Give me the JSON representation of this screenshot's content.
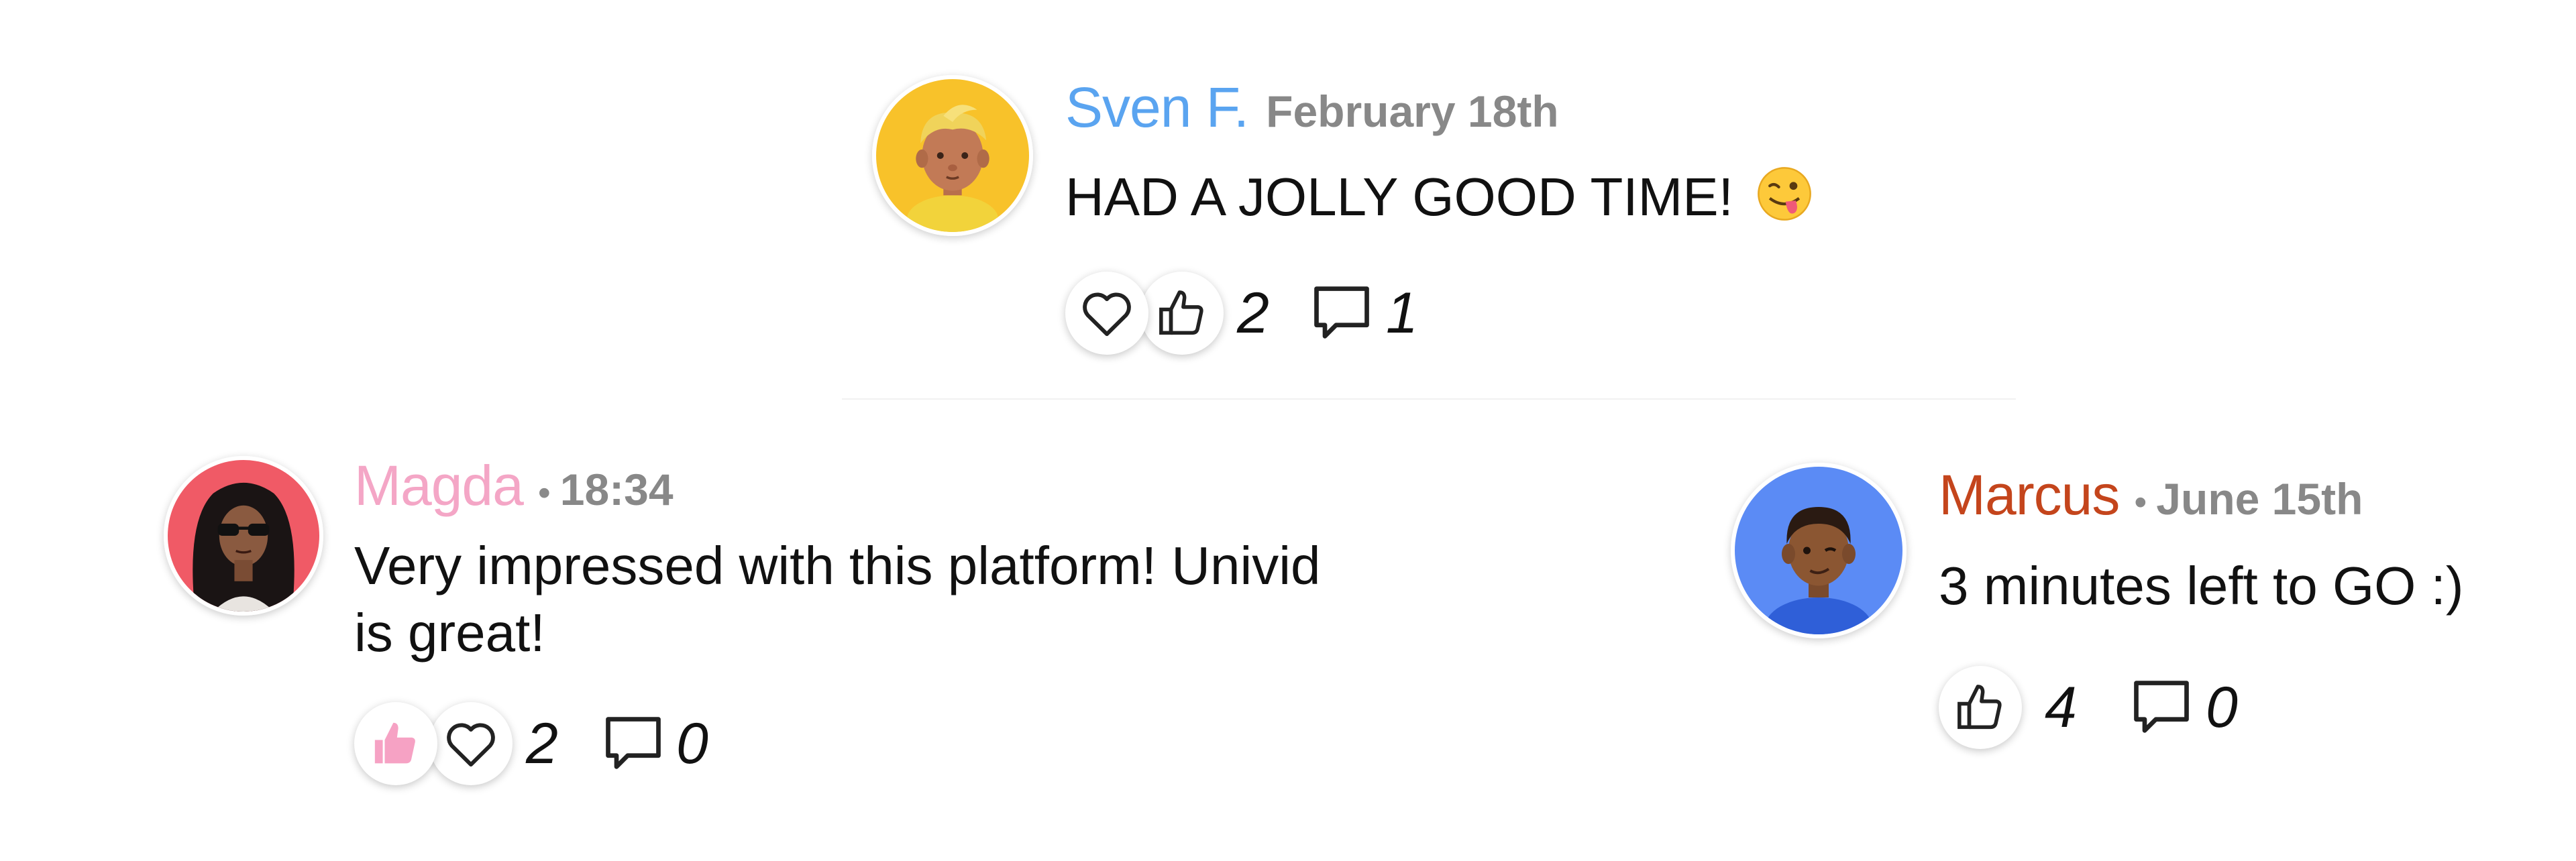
{
  "colors": {
    "sven": "#5aa4f0",
    "magda": "#f4a6c6",
    "marcus": "#c4451c",
    "liked_pink": "#f6a2c4",
    "meta_gray": "#888888"
  },
  "comments": [
    {
      "author": "Sven F.",
      "date": "February 18th",
      "text": "HAD A JOLLY GOOD TIME!",
      "emoji": "winking-face-with-tongue",
      "reactions": [
        "heart-icon",
        "thumbs-up-icon"
      ],
      "reaction_count": "2",
      "reply_count": "1"
    },
    {
      "author": "Magda",
      "separator": "•",
      "date": "18:34",
      "text_line1": "Very impressed with this platform! Univid",
      "text_line2": "is great!",
      "reactions": [
        "thumbs-up-icon-filled",
        "heart-icon"
      ],
      "reaction_count": "2",
      "reply_count": "0"
    },
    {
      "author": "Marcus",
      "separator": "•",
      "date": "June 15th",
      "text": "3 minutes left to GO :)",
      "reactions": [
        "thumbs-up-icon"
      ],
      "reaction_count": "4",
      "reply_count": "0"
    }
  ]
}
